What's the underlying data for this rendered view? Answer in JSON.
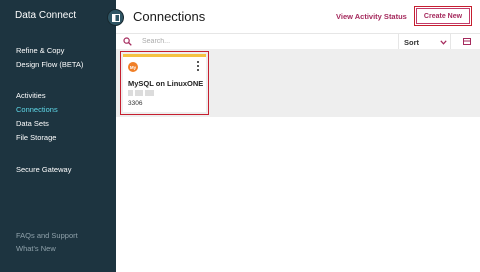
{
  "sidebar": {
    "app_title": "Data Connect",
    "items": [
      {
        "label": "Refine & Copy"
      },
      {
        "label": "Design Flow (BETA)"
      },
      {
        "label": "Activities"
      },
      {
        "label": "Connections",
        "active": true
      },
      {
        "label": "Data Sets"
      },
      {
        "label": "File Storage"
      },
      {
        "label": "Secure Gateway"
      }
    ],
    "footer": [
      {
        "label": "FAQs and Support"
      },
      {
        "label": "What's New"
      }
    ]
  },
  "header": {
    "title": "Connections",
    "activity_link": "View Activity Status",
    "create_button": "Create New"
  },
  "toolbar": {
    "search_placeholder": "Search...",
    "sort_label": "Sort"
  },
  "connections": [
    {
      "logo_text": "My",
      "title": "MySQL on LinuxONE",
      "port": "3306"
    }
  ],
  "colors": {
    "sidebar_bg": "#1d3440",
    "active_nav": "#5fd8e8",
    "accent": "#a52a5d",
    "highlight_box": "#c61f2f",
    "card_top": "#f5c242",
    "mysql_logo": "#f07f27"
  },
  "icons": {
    "collapse": "collapse-sidebar-icon",
    "search": "search-icon",
    "sort": "chevron-down-icon",
    "view": "grid-view-icon",
    "card_menu": "kebab-menu-icon"
  }
}
